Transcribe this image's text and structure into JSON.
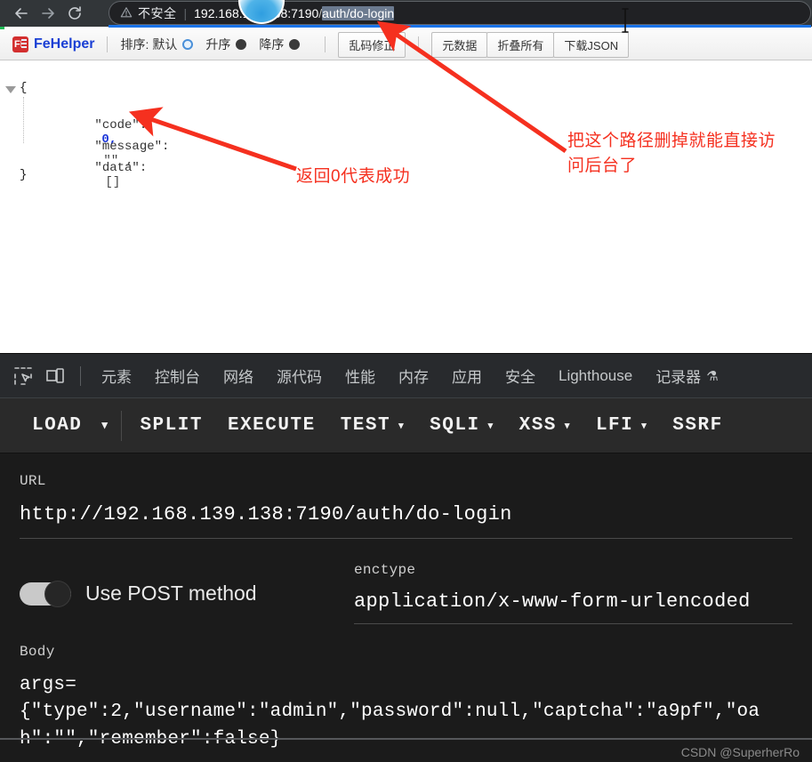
{
  "browser": {
    "nav": {
      "back": "←",
      "forward": "→",
      "reload": "⟳"
    },
    "omnibox": {
      "warning_icon": "⚠",
      "warning_text": "不安全",
      "separator": "|",
      "url_host": "192.168.139.138:7190",
      "url_slash": "/",
      "url_path_selected": "auth/do-login",
      "full_url": "192.168.139.138:7190/auth/do-login"
    }
  },
  "fehelper": {
    "logo_text": "FE",
    "name": "FeHelper",
    "sort_label": "排序:",
    "sort_options": [
      {
        "label": "默认",
        "selected": true
      },
      {
        "label": "升序",
        "selected": false
      },
      {
        "label": "降序",
        "selected": false
      }
    ],
    "fix_button": "乱码修正",
    "right_buttons": [
      "元数据",
      "折叠所有",
      "下载JSON"
    ]
  },
  "json_viewer": {
    "open_brace": "{",
    "close_brace": "}",
    "rows": [
      {
        "key": "\"code\":",
        "value": "0,",
        "type": "number"
      },
      {
        "key": "\"message\":",
        "value": "\"\" ,",
        "type": "string"
      },
      {
        "key": "\"data\":",
        "value": "[]",
        "type": "array"
      }
    ]
  },
  "annotations": [
    {
      "text": "返回0代表成功",
      "color": "#f5301f"
    },
    {
      "text": "把这个路径删掉就能直接访",
      "color": "#f5301f"
    },
    {
      "text": "问后台了",
      "color": "#f5301f"
    }
  ],
  "devtools": {
    "icons": [
      "inspect-element-icon",
      "device-toolbar-icon"
    ],
    "tabs": [
      {
        "label": "元素"
      },
      {
        "label": "控制台"
      },
      {
        "label": "网络"
      },
      {
        "label": "源代码"
      },
      {
        "label": "性能"
      },
      {
        "label": "内存"
      },
      {
        "label": "应用"
      },
      {
        "label": "安全"
      },
      {
        "label": "Lighthouse"
      },
      {
        "label": "记录器",
        "flask": "⚗"
      }
    ]
  },
  "hackbar": {
    "buttons": [
      {
        "label": "LOAD",
        "has_caret": true,
        "caret_separate": true
      },
      {
        "label": "SPLIT",
        "has_caret": false
      },
      {
        "label": "EXECUTE",
        "has_caret": false
      },
      {
        "label": "TEST",
        "has_caret": true
      },
      {
        "label": "SQLI",
        "has_caret": true
      },
      {
        "label": "XSS",
        "has_caret": true
      },
      {
        "label": "LFI",
        "has_caret": true
      },
      {
        "label": "SSRF",
        "has_caret": false
      }
    ],
    "caret_glyph": "▾",
    "url_label": "URL",
    "url_value": "http://192.168.139.138:7190/auth/do-login",
    "post_toggle_label": "Use POST method",
    "post_toggle_on": false,
    "enctype_label": "enctype",
    "enctype_value": "application/x-www-form-urlencoded",
    "body_label": "Body",
    "body_line1": "args=",
    "body_line2": "{\"type\":2,\"username\":\"admin\",\"password\":null,\"captcha\":\"a9pf\",\"oah\":\"\",\"remember\":false}"
  },
  "watermark": "CSDN @SuperherRo",
  "colors": {
    "chrome_bg": "#323639",
    "omnibox_bg": "#202124",
    "accent_blue": "#1a73e8",
    "annotation_red": "#f5301f",
    "devtools_bg": "#202124",
    "hackbar_bg": "#2a2a2a",
    "fehelper_blue": "#1a3fd4"
  }
}
